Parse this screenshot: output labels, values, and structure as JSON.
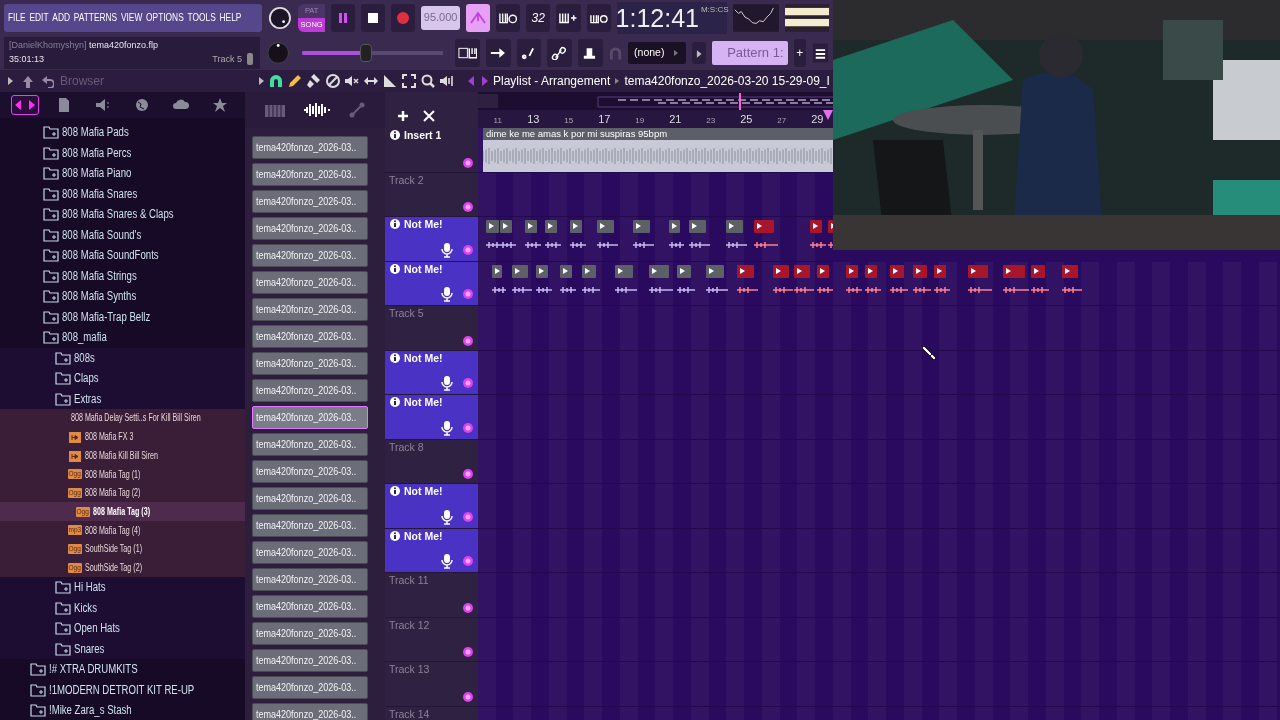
{
  "menu": [
    "FILE",
    "EDIT",
    "ADD",
    "PATTERNS",
    "VIEW",
    "OPTIONS",
    "TOOLS",
    "HELP"
  ],
  "transport": {
    "modes": [
      {
        "label": "PAT",
        "selected": false
      },
      {
        "label": "SONG",
        "selected": true
      }
    ],
    "playing": true,
    "tempo": "95.000",
    "metronome_on": true,
    "counter": "32",
    "time": "1:12:41",
    "time_format": "M:S:CS"
  },
  "hint": {
    "user": "[DanielKhomyshyn]",
    "file": "tema420fonzo.flp",
    "elapsed": "35:01:13",
    "track": "Track 5"
  },
  "pitch_slider": {
    "level": 0.45
  },
  "snap": "(none)",
  "pattern": "Pattern 1:",
  "pattern_add": "+",
  "browser": {
    "title": "Browser",
    "tabs": [
      {
        "selected": true
      },
      {
        "selected": false
      },
      {
        "selected": false
      },
      {
        "selected": false
      },
      {
        "selected": false
      },
      {
        "selected": false
      }
    ],
    "tree": [
      {
        "children": [
          {
            "label": "808 Mafia Pads"
          },
          {
            "label": "808 Mafia Percs"
          },
          {
            "label": "808 Mafia Piano"
          },
          {
            "label": "808 Mafia Snares"
          },
          {
            "label": "808 Mafia Snares & Claps"
          },
          {
            "label": "808 Mafia Sound's"
          },
          {
            "label": "808 Mafia SoundFonts"
          },
          {
            "label": "808 Mafia Strings"
          },
          {
            "label": "808 Mafia Synths"
          },
          {
            "label": "808 Mafia-Trap Bellz"
          },
          {
            "label": "808_mafia",
            "children": [
              {
                "label": "808s"
              },
              {
                "label": "Claps"
              },
              {
                "label": "Extras",
                "children": [
                  {
                    "label": "808 Mafia Delay Setti..s For Kill Bill Siren",
                    "kind": "preset",
                    "selected": false
                  },
                  {
                    "label": "808 Mafia FX 3",
                    "kind": "clip",
                    "selected": false
                  },
                  {
                    "label": "808 Mafia Kill Bill Siren",
                    "kind": "clip",
                    "selected": false
                  },
                  {
                    "label": "808 Mafia Tag (1)",
                    "kind": "audio",
                    "badge": "Ogg",
                    "selected": false
                  },
                  {
                    "label": "808 Mafia Tag (2)",
                    "kind": "audio",
                    "badge": "Ogg",
                    "selected": false
                  },
                  {
                    "label": "808 Mafia Tag (3)",
                    "kind": "audio",
                    "badge": "Ogg",
                    "selected": true
                  },
                  {
                    "label": "808 Mafia Tag (4)",
                    "kind": "audio",
                    "badge": "mp3",
                    "selected": false
                  },
                  {
                    "label": "SouthSide Tag (1)",
                    "kind": "audio",
                    "badge": "Ogg",
                    "selected": false
                  },
                  {
                    "label": "SouthSide Tag (2)",
                    "kind": "audio",
                    "badge": "Ogg",
                    "selected": false
                  }
                ]
              },
              {
                "label": "Hi Hats"
              },
              {
                "label": "Kicks"
              },
              {
                "label": "Open Hats"
              },
              {
                "label": "Snares"
              }
            ]
          }
        ]
      },
      {
        "label": "!# XTRA DRUMKITS"
      },
      {
        "label": "!1MODERN DETROIT KIT RE-UP"
      },
      {
        "label": "!Mike Zara_s Stash"
      }
    ]
  },
  "playlist": {
    "title": "Playlist - Arrangement",
    "song": "tema420fonzo_2026-03-20 15-29-09_I",
    "ruler": [
      "11",
      "13",
      "15",
      "17",
      "19",
      "21",
      "23",
      "25",
      "27",
      "29"
    ]
  },
  "clip_sources": [
    {
      "label": "tema420fonzo_2026-03..",
      "selected": false
    },
    {
      "label": "tema420fonzo_2026-03..",
      "selected": false
    },
    {
      "label": "tema420fonzo_2026-03..",
      "selected": false
    },
    {
      "label": "tema420fonzo_2026-03..",
      "selected": false
    },
    {
      "label": "tema420fonzo_2026-03..",
      "selected": false
    },
    {
      "label": "tema420fonzo_2026-03..",
      "selected": false
    },
    {
      "label": "tema420fonzo_2026-03..",
      "selected": false
    },
    {
      "label": "tema420fonzo_2026-03..",
      "selected": false
    },
    {
      "label": "tema420fonzo_2026-03..",
      "selected": false
    },
    {
      "label": "tema420fonzo_2026-03..",
      "selected": false
    },
    {
      "label": "tema420fonzo_2026-03..",
      "selected": true
    },
    {
      "label": "tema420fonzo_2026-03..",
      "selected": false
    },
    {
      "label": "tema420fonzo_2026-03..",
      "selected": false
    },
    {
      "label": "tema420fonzo_2026-03..",
      "selected": false
    },
    {
      "label": "tema420fonzo_2026-03..",
      "selected": false
    },
    {
      "label": "tema420fonzo_2026-03..",
      "selected": false
    },
    {
      "label": "tema420fonzo_2026-03..",
      "selected": false
    },
    {
      "label": "tema420fonzo_2026-03..",
      "selected": false
    },
    {
      "label": "tema420fonzo_2026-03..",
      "selected": false
    },
    {
      "label": "tema420fonzo_2026-03..",
      "selected": false
    },
    {
      "label": "tema420fonzo_2026-03..",
      "selected": false
    },
    {
      "label": "tema420fonzo_2026-03..",
      "selected": false
    }
  ],
  "tracks": [
    {
      "name": "Insert 1",
      "kind": "insert",
      "clips": [
        {
          "kind": "audio",
          "label": "dime ke me amas k por mi suspiras 95bpm"
        }
      ]
    },
    {
      "name": "Track 2",
      "kind": "plain"
    },
    {
      "name": "Not Me!",
      "kind": "armed",
      "clips": [
        {
          "kind": "sample",
          "color": "#5e6068"
        },
        {
          "kind": "sample",
          "color": "#5e6068"
        },
        {
          "kind": "sample",
          "color": "#5e6068"
        },
        {
          "kind": "sample",
          "color": "#5e6068"
        },
        {
          "kind": "sample",
          "color": "#5e6068"
        },
        {
          "kind": "sample",
          "color": "#5e6068"
        },
        {
          "kind": "sample",
          "color": "#5e6068"
        },
        {
          "kind": "sample",
          "color": "#5e6068"
        },
        {
          "kind": "sample",
          "color": "#5e6068"
        },
        {
          "kind": "sample",
          "color": "#5e6068"
        },
        {
          "kind": "sample",
          "color": "#a8162c"
        },
        {
          "kind": "sample",
          "color": "#a8162c"
        },
        {
          "kind": "sample",
          "color": "#a8162c"
        }
      ]
    },
    {
      "name": "Not Me!",
      "kind": "armed",
      "clips": [
        {
          "kind": "sample",
          "color": "#5e6068"
        },
        {
          "kind": "sample",
          "color": "#5e6068"
        },
        {
          "kind": "sample",
          "color": "#5e6068"
        },
        {
          "kind": "sample",
          "color": "#5e6068"
        },
        {
          "kind": "sample",
          "color": "#5e6068"
        },
        {
          "kind": "sample",
          "color": "#5e6068"
        },
        {
          "kind": "sample",
          "color": "#5e6068"
        },
        {
          "kind": "sample",
          "color": "#5e6068"
        },
        {
          "kind": "sample",
          "color": "#5e6068"
        },
        {
          "kind": "sample",
          "color": "#a8162c"
        },
        {
          "kind": "sample",
          "color": "#a8162c"
        },
        {
          "kind": "sample",
          "color": "#a8162c"
        },
        {
          "kind": "sample",
          "color": "#a8162c"
        },
        {
          "kind": "sample",
          "color": "#a8162c"
        },
        {
          "kind": "sample",
          "color": "#a8162c"
        },
        {
          "kind": "sample",
          "color": "#a8162c"
        },
        {
          "kind": "sample",
          "color": "#a8162c"
        },
        {
          "kind": "sample",
          "color": "#a8162c"
        },
        {
          "kind": "sample",
          "color": "#a8162c"
        },
        {
          "kind": "sample",
          "color": "#a8162c"
        },
        {
          "kind": "sample",
          "color": "#a8162c"
        },
        {
          "kind": "sample",
          "color": "#a8162c"
        }
      ]
    },
    {
      "name": "Track 5",
      "kind": "plain"
    },
    {
      "name": "Not Me!",
      "kind": "armed"
    },
    {
      "name": "Not Me!",
      "kind": "armed"
    },
    {
      "name": "Track 8",
      "kind": "plain"
    },
    {
      "name": "Not Me!",
      "kind": "armed"
    },
    {
      "name": "Not Me!",
      "kind": "armed"
    },
    {
      "name": "Track 11",
      "kind": "plain"
    },
    {
      "name": "Track 12",
      "kind": "plain"
    },
    {
      "name": "Track 13",
      "kind": "plain"
    },
    {
      "name": "Track 14",
      "kind": "plain"
    }
  ],
  "webcam": {
    "kind": "picture"
  }
}
